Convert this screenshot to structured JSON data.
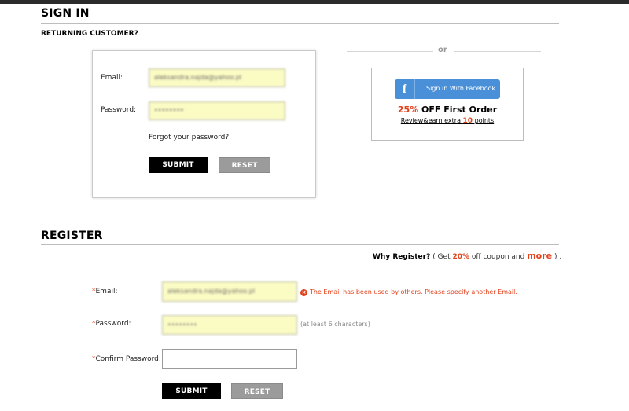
{
  "signin": {
    "title": "SIGN IN",
    "subtitle": "RETURNING CUSTOMER?",
    "email_label": "Email:",
    "email_value": "aleksandra.najda@yahoo.pl",
    "password_label": "Password:",
    "password_value": "••••••••",
    "forgot_link": "Forgot your password?",
    "submit_label": "SUBMIT",
    "reset_label": "RESET"
  },
  "divider": {
    "or": "or"
  },
  "facebook": {
    "icon": "f",
    "button_label": "Sign in With Facebook",
    "promo_pct": "25%",
    "promo_rest": " OFF First Order",
    "review_prefix": "Review&earn extra ",
    "review_points": "10",
    "review_suffix": " points"
  },
  "register": {
    "title": "REGISTER",
    "why_title": "Why Register?",
    "why_open": " ( Get ",
    "why_pct": "20%",
    "why_mid": " off coupon and ",
    "why_more": "more",
    "why_close": " ) .",
    "required_mark": "*",
    "email_label": "Email:",
    "email_value": "aleksandra.najda@yahoo.pl",
    "email_error": "The Email has been used by others. Please specify another Email.",
    "password_label": "Password:",
    "password_value": "••••••••",
    "password_hint": "(at least 6 characters)",
    "confirm_label": "Confirm Password:",
    "confirm_value": "",
    "submit_label": "SUBMIT",
    "reset_label": "RESET"
  },
  "colors": {
    "accent_red": "#e2401a",
    "facebook_blue": "#4a90d9",
    "autofill_yellow": "#fbfbc4"
  }
}
